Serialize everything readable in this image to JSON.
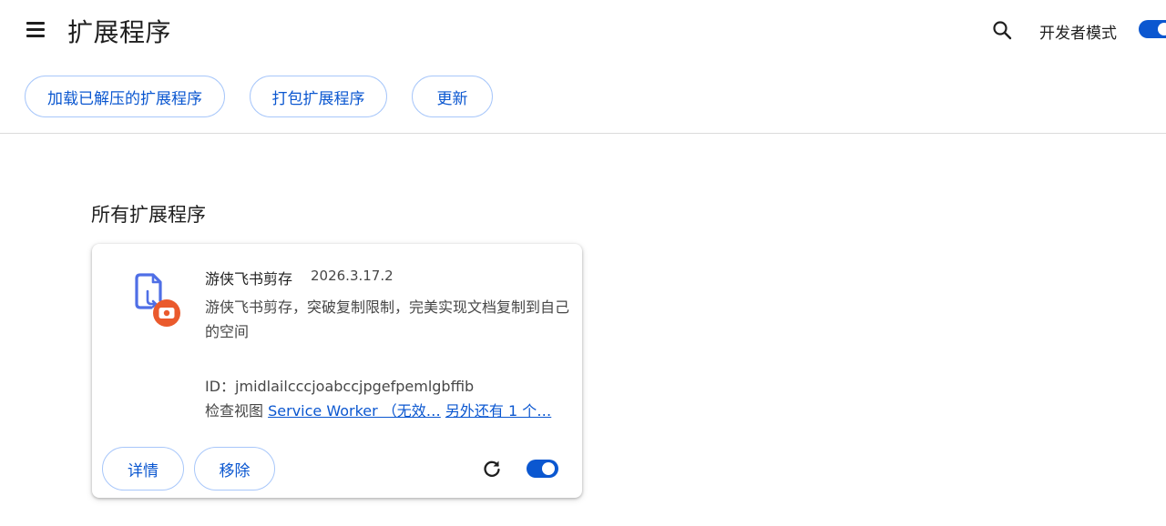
{
  "header": {
    "title": "扩展程序",
    "developer_mode_label": "开发者模式",
    "developer_mode_on": true
  },
  "toolbar": {
    "load_unpacked_label": "加载已解压的扩展程序",
    "pack_label": "打包扩展程序",
    "update_label": "更新"
  },
  "section": {
    "title": "所有扩展程序"
  },
  "extension": {
    "name": "游侠飞书剪存",
    "version": "2026.3.17.2",
    "description": "游侠飞书剪存，突破复制限制，完美实现文档复制到自己的空间",
    "id_text": "ID：jmidlailcccjoabccjpgefpemlgbffib",
    "inspect_label": "检查视图",
    "inspect_link_1": "Service Worker （无效…",
    "inspect_link_2": " 另外还有 1 个…",
    "details_label": "详情",
    "remove_label": "移除",
    "enabled": true
  },
  "colors": {
    "accent": "#0b57d0",
    "pill_border": "#a8c7fa",
    "icon_blue": "#4f6fe6",
    "icon_badge": "#ea5a2d"
  },
  "icons": [
    "menu-icon",
    "search-icon",
    "extension-icon",
    "reload-icon"
  ]
}
